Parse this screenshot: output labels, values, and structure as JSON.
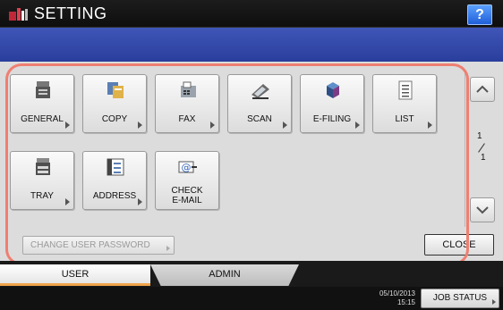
{
  "title_bar": {
    "title": "SETTING",
    "help_label": "?"
  },
  "functions": [
    {
      "label": "GENERAL",
      "icon": "general-icon"
    },
    {
      "label": "COPY",
      "icon": "copy-icon"
    },
    {
      "label": "FAX",
      "icon": "fax-icon"
    },
    {
      "label": "SCAN",
      "icon": "scan-icon"
    },
    {
      "label": "E-FILING",
      "icon": "e-filing-icon"
    },
    {
      "label": "LIST",
      "icon": "list-icon"
    },
    {
      "label": "TRAY",
      "icon": "tray-icon"
    },
    {
      "label": "ADDRESS",
      "icon": "address-icon"
    },
    {
      "label": "CHECK\nE-MAIL",
      "icon": "check-email-icon"
    }
  ],
  "pager": {
    "current": "1",
    "total": "1"
  },
  "change_password_label": "CHANGE USER PASSWORD",
  "close_label": "CLOSE",
  "tabs": {
    "user": "USER",
    "admin": "ADMIN"
  },
  "status": {
    "date": "05/10/2013",
    "time": "15:15",
    "job_status_label": "JOB STATUS"
  },
  "colors": {
    "title_bar": "#111111",
    "blue_band": "#3347ae",
    "highlight": "#ef7f72",
    "active_tab_accent": "#f0a44c"
  }
}
